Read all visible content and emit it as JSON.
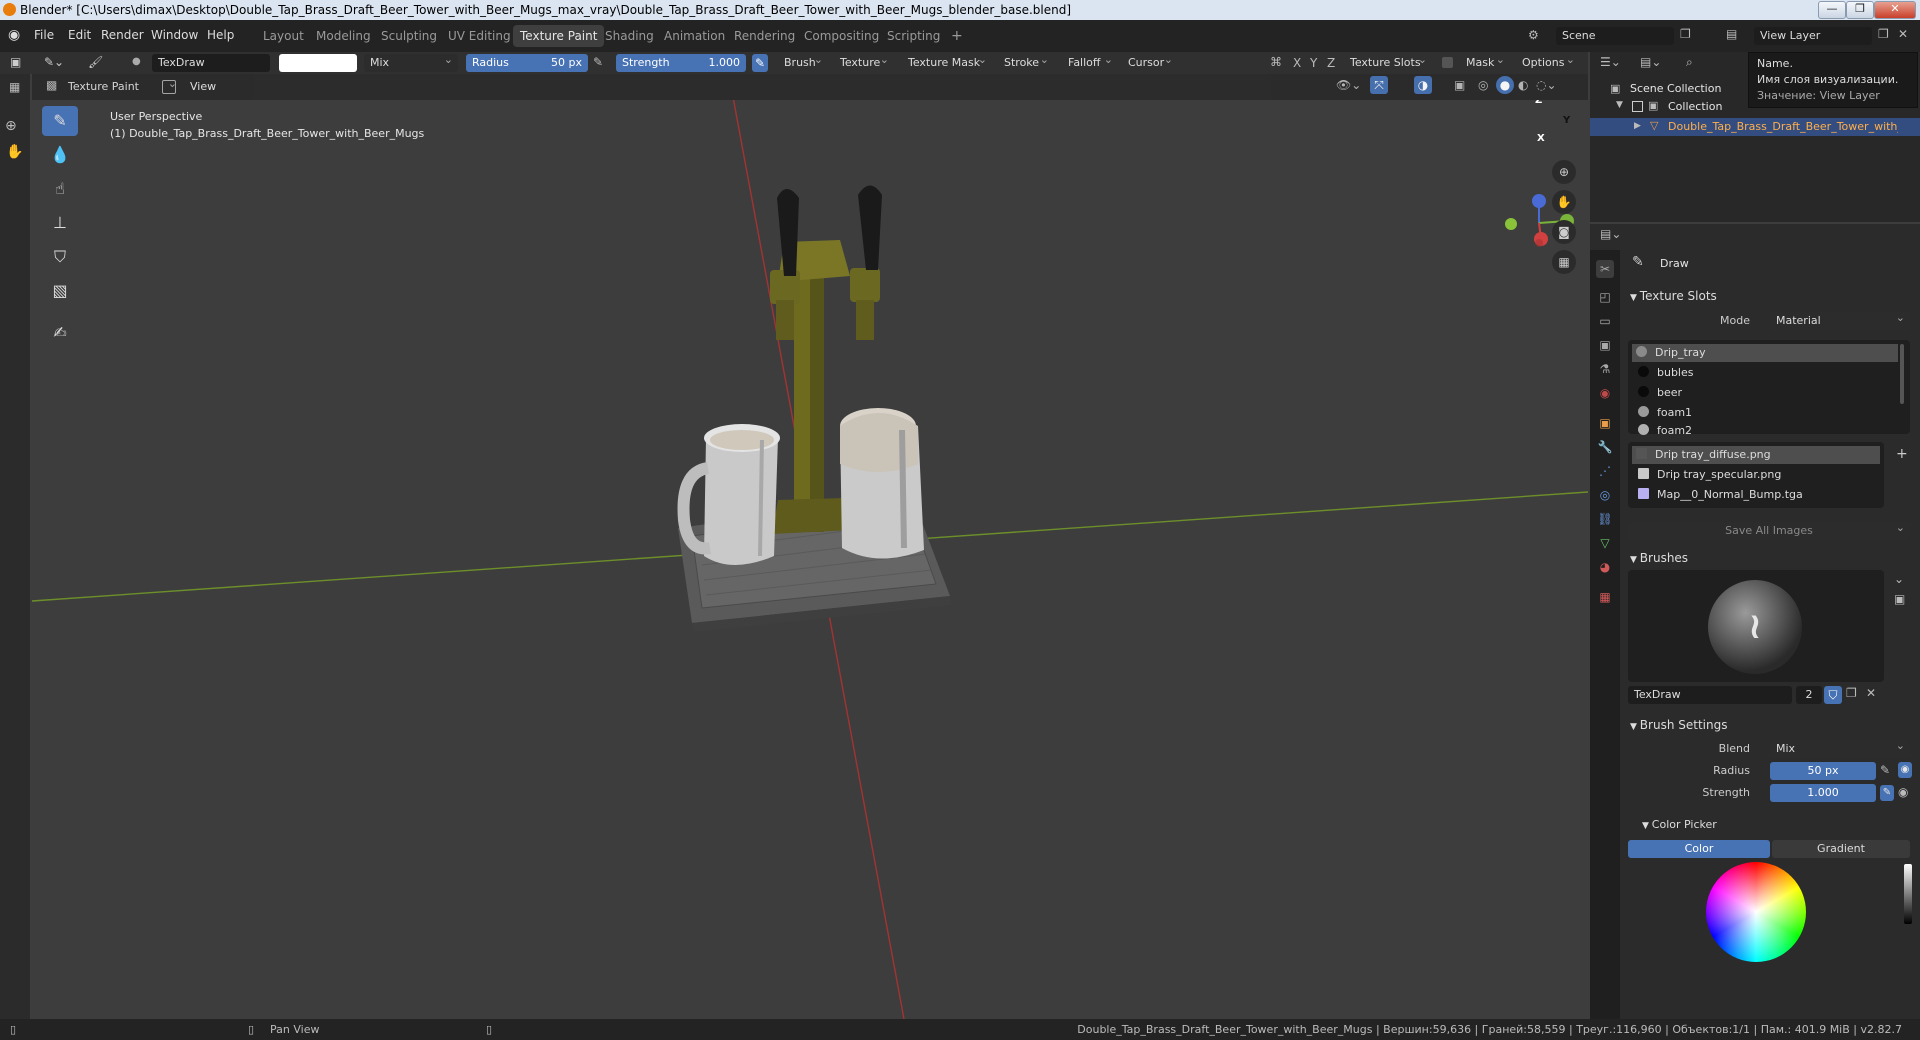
{
  "window_title": "Blender* [C:\\Users\\dimax\\Desktop\\Double_Tap_Brass_Draft_Beer_Tower_with_Beer_Mugs_max_vray\\Double_Tap_Brass_Draft_Beer_Tower_with_Beer_Mugs_blender_base.blend]",
  "window_buttons": {
    "minimize": "—",
    "maximize": "❐",
    "close": "✕"
  },
  "menu": [
    "File",
    "Edit",
    "Render",
    "Window",
    "Help"
  ],
  "workspaces": [
    "Layout",
    "Modeling",
    "Sculpting",
    "UV Editing",
    "Texture Paint",
    "Shading",
    "Animation",
    "Rendering",
    "Compositing",
    "Scripting"
  ],
  "active_workspace": "Texture Paint",
  "add_workspace": "+",
  "scene": {
    "label": "Scene",
    "view_layer": "View Layer"
  },
  "tool_header": {
    "brush_name": "TexDraw",
    "blend": "Mix",
    "radius_label": "Radius",
    "radius_value": "50 px",
    "strength_label": "Strength",
    "strength_value": "1.000",
    "menus": [
      "Brush",
      "Texture",
      "Texture Mask",
      "Stroke",
      "Falloff",
      "Cursor"
    ],
    "axes": [
      "X",
      "Y",
      "Z"
    ],
    "texture_slots": "Texture Slots",
    "mask": "Mask",
    "options": "Options"
  },
  "header2": {
    "mode": "Texture Paint",
    "view": "View"
  },
  "viewport": {
    "perspective": "User Perspective",
    "object": "(1) Double_Tap_Brass_Draft_Beer_Tower_with_Beer_Mugs",
    "gizmo_labels": {
      "z": "Z",
      "y": "Y",
      "x": "X"
    }
  },
  "outliner": {
    "scene_collection": "Scene Collection",
    "collection": "Collection",
    "object": "Double_Tap_Brass_Draft_Beer_Tower_with_Beer_Mugs"
  },
  "tooltip": {
    "line1": "Name.",
    "line2": "Имя слоя визуализации.",
    "line3": "Значение: View Layer"
  },
  "properties": {
    "tool_name": "Draw",
    "texture_slots_title": "Texture Slots",
    "mode_label": "Mode",
    "mode_value": "Material",
    "materials": [
      {
        "name": "Drip_tray",
        "color": "#8a8a8a"
      },
      {
        "name": "bubles",
        "color": "#0a0a0a"
      },
      {
        "name": "beer",
        "color": "#0a0a0a"
      },
      {
        "name": "foam1",
        "color": "#9a9a9a"
      },
      {
        "name": "foam2",
        "color": "#b0b0b0"
      }
    ],
    "images": [
      {
        "name": "Drip tray_diffuse.png",
        "color": "#555555"
      },
      {
        "name": "Drip tray_specular.png",
        "color": "#c8c8c8"
      },
      {
        "name": "Map__0_Normal_Bump.tga",
        "color": "#b8b0f0"
      }
    ],
    "save_all": "Save All Images",
    "brushes_title": "Brushes",
    "brush_name": "TexDraw",
    "brush_users": "2",
    "brush_settings_title": "Brush Settings",
    "blend_label": "Blend",
    "blend_value": "Mix",
    "radius_label": "Radius",
    "radius_value": "50 px",
    "strength_label": "Strength",
    "strength_value": "1.000",
    "color_picker_title": "Color Picker",
    "color_tab": "Color",
    "gradient_tab": "Gradient"
  },
  "status": {
    "pan": "Pan View",
    "info": "Double_Tap_Brass_Draft_Beer_Tower_with_Beer_Mugs | Вершин:59,636 | Граней:58,559 | Треуг.:116,960 | Объектов:1/1 | Пам.: 401.9 MiB | v2.82.7"
  },
  "colors": {
    "accent": "#4772b3",
    "header": "#303030",
    "bg": "#3d3d3d"
  }
}
